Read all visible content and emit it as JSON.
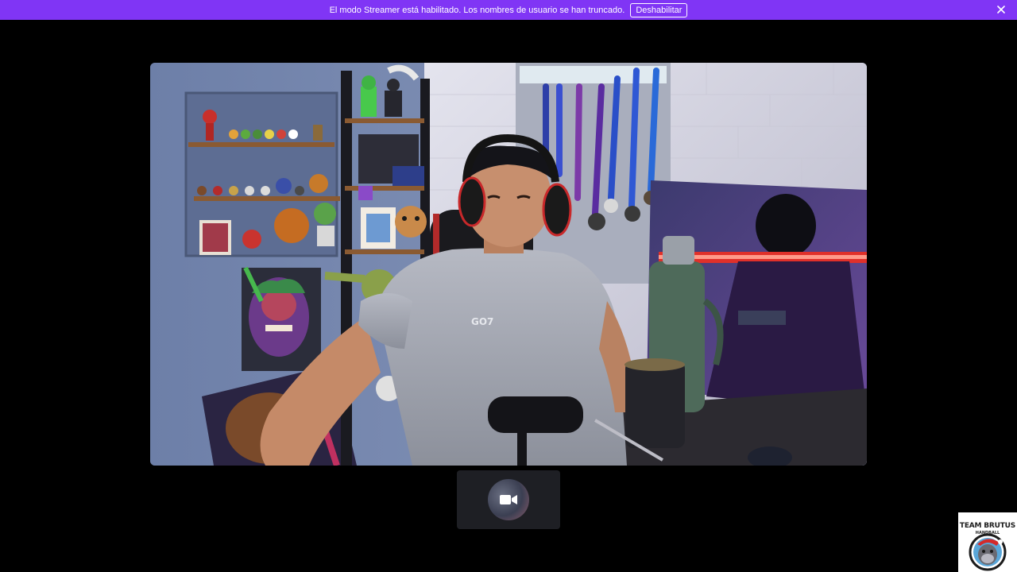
{
  "banner": {
    "message": "El modo Streamer está habilitado. Los nombres de usuario se han truncado.",
    "disable_label": "Deshabilitar",
    "background": "#8035f5",
    "close_icon": "close-icon"
  },
  "stream": {
    "content": "camera-feed",
    "preview_icon": "video-camera-icon"
  },
  "logo": {
    "line1": "TEAM BRUTUS",
    "line2": "HANDBALL"
  }
}
